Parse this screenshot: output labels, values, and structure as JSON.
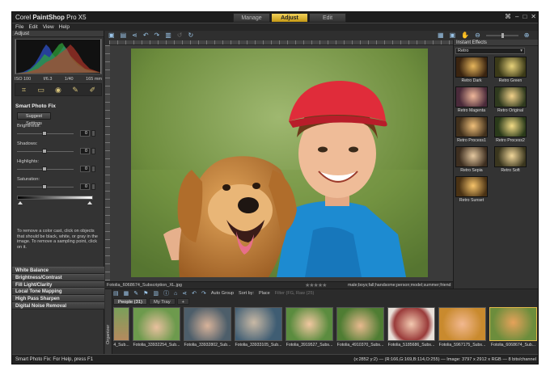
{
  "app": {
    "title_prefix": "Corel ",
    "title_name": "PaintShop",
    "title_suffix": " Pro X5",
    "modes": [
      "Manage",
      "Adjust",
      "Edit"
    ],
    "active_mode": "Adjust"
  },
  "menu": [
    "File",
    "Edit",
    "View",
    "Help"
  ],
  "left_panel": {
    "header": "Adjust",
    "exif": [
      "ISO 100",
      "f/6.3",
      "1/40",
      "165 mm"
    ],
    "spf_title": "Smart Photo Fix",
    "suggest_label": "Suggest Settings",
    "sliders": [
      {
        "label": "Brightness:",
        "value": "0"
      },
      {
        "label": "Shadows:",
        "value": "0"
      },
      {
        "label": "Highlights:",
        "value": "0"
      },
      {
        "label": "Saturation:",
        "value": "0"
      }
    ],
    "help_text": "To remove a color cast, click on objects that should be black, white, or gray in the image. To remove a sampling point, click on it.",
    "sections": [
      "White Balance",
      "Brightness/Contrast",
      "Fill Light/Clarity",
      "Local Tone Mapping",
      "High Pass Sharpen",
      "Digital Noise Removal"
    ]
  },
  "photo_bar": {
    "filename": "Fotolia_6068674_Subscription_XL.jpg",
    "stars": "★★★★★",
    "tags": "male;boys;fall;handsome;person;model;summer;friend;families;animals;baseball;dogs;golden;hats;pets;retriever"
  },
  "right_panel": {
    "header": "Instant Effects",
    "category": "Retro",
    "effects": [
      "Retro Dark",
      "Retro Green",
      "Retro Magenta",
      "Retro Original",
      "Retro Process1",
      "Retro Process2",
      "Retro Sepia",
      "Retro Soft",
      "Retro Sunset"
    ]
  },
  "organizer": {
    "group_label": "Auto Group",
    "sort_label": "Sort by:",
    "sort_value": "Place",
    "filter_label": "Filter (FG, Raw (25)",
    "side_label": "Organizer",
    "tabs": [
      "People (31)",
      "My Tray",
      "+"
    ],
    "thumbs": [
      "Fotolia_33932254_Sub...",
      "Fotolia_33932802_Sub...",
      "Fotolia_33933105_Sub...",
      "Fotolia_3919527_Subs...",
      "Fotolia_4910370_Subs...",
      "Fotolia_5185686_Subs...",
      "Fotolia_5967175_Subs...",
      "Fotolia_6068674_Sub..."
    ],
    "partial_thumb_cap": "4_Sub..."
  },
  "status": {
    "left": "Smart Photo Fix: For Help, press F1",
    "right": "(x:2852 y:2) — (R:166,G:169,B:114,O:255) — Image: 3797 x 2912 x RGB — 8 bits/channel"
  },
  "colors": {
    "accent": "#e2b94a",
    "panel": "#333333",
    "toolbar_icon": "#9bc5e8"
  }
}
